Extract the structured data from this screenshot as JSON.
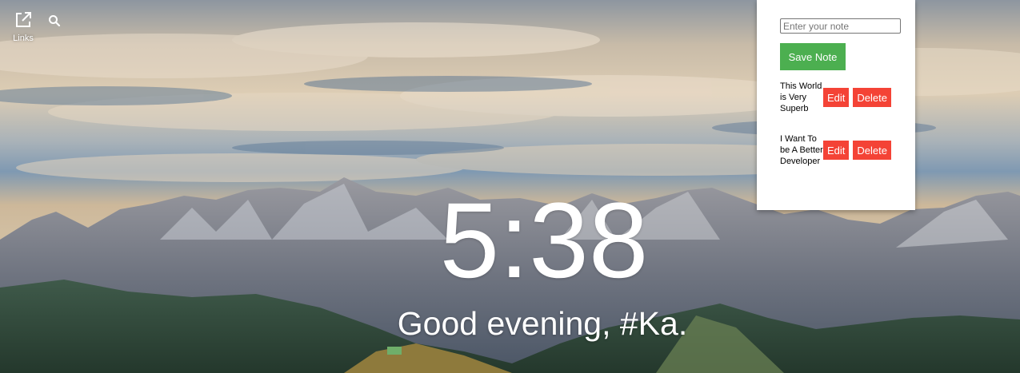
{
  "links": {
    "label": "Links",
    "icon": "external-link-icon"
  },
  "search": {
    "icon": "search-icon"
  },
  "notes": {
    "input_placeholder": "Enter your note",
    "input_value": "",
    "save_label": "Save Note",
    "items": [
      {
        "text": "This World is Very Superb",
        "edit_label": "Edit",
        "delete_label": "Delete"
      },
      {
        "text": "I Want To be A Better Developer",
        "edit_label": "Edit",
        "delete_label": "Delete"
      }
    ]
  },
  "clock": {
    "time": "5:38"
  },
  "greeting": {
    "text": "Good evening, #Ka."
  },
  "colors": {
    "save_button": "#4caf50",
    "edit_delete_button": "#f44336",
    "panel_background": "#ffffff"
  }
}
